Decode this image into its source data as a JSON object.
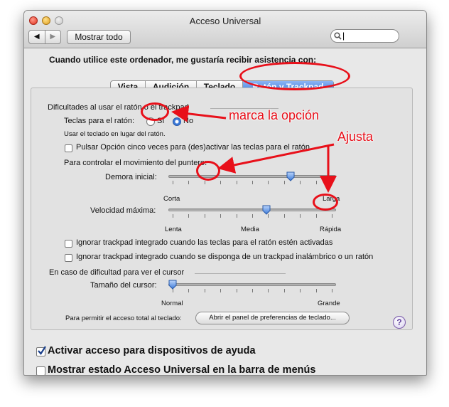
{
  "window": {
    "title": "Acceso Universal",
    "show_all_label": "Mostrar todo",
    "search_placeholder": ""
  },
  "intro": "Cuando utilice este ordenador, me gustaría recibir asistencia con:",
  "tabs": [
    {
      "label": "Vista",
      "selected": false
    },
    {
      "label": "Audición",
      "selected": false
    },
    {
      "label": "Teclado",
      "selected": false
    },
    {
      "label": "Ratón y Trackpad",
      "selected": true
    }
  ],
  "mouse_section": {
    "heading": "Dificultades al usar el ratón o el trackpad",
    "mouse_keys_label": "Teclas para el ratón:",
    "option_yes": "Sí",
    "option_no": "No",
    "selected_option": "No",
    "mouse_keys_hint": "Usar el teclado en lugar del ratón.",
    "option_press_label": "Pulsar Opción cinco veces para (des)activar las teclas para el ratón",
    "option_press_checked": false,
    "pointer_heading": "Para controlar el movimiento del puntero:",
    "initial_delay_label": "Demora inicial:",
    "initial_delay_min": "Corta",
    "initial_delay_max": "Larga",
    "initial_delay_value": 0.74,
    "max_speed_label": "Velocidad máxima:",
    "max_speed_min": "Lenta",
    "max_speed_mid": "Media",
    "max_speed_max": "Rápida",
    "max_speed_value": 0.59,
    "ignore_trackpad_mousekeys": "Ignorar trackpad integrado cuando las teclas para el ratón estén activadas",
    "ignore_trackpad_mousekeys_checked": false,
    "ignore_trackpad_wireless": "Ignorar trackpad integrado cuando se disponga de un trackpad inalámbrico o un ratón",
    "ignore_trackpad_wireless_checked": false
  },
  "cursor_section": {
    "heading": "En caso de dificultad para ver el cursor",
    "size_label": "Tamaño del cursor:",
    "size_min": "Normal",
    "size_max": "Grande",
    "size_value": 0.0,
    "keyboard_access_label": "Para permitir el acceso total al teclado:",
    "open_keyboard_prefs_button": "Abrir el panel de preferencias de teclado...",
    "help_button": "?"
  },
  "bottom": {
    "assistive_devices_label": "Activar acceso para dispositivos de ayuda",
    "assistive_devices_checked": true,
    "menu_bar_status_label": "Mostrar estado Acceso Universal en la barra de menús",
    "menu_bar_status_checked": false
  },
  "annotations": {
    "mark_option": "marca la opción",
    "adjust": "Ajusta",
    "color": "#e8101a"
  },
  "colors": {
    "accent": "#3a78d8",
    "highlight_red": "#e8101a"
  }
}
